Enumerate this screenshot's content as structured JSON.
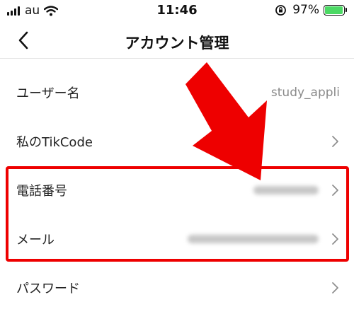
{
  "status_bar": {
    "carrier": "au",
    "time": "11:46",
    "battery_percent": "97%",
    "battery_level": 0.97,
    "battery_color": "#4cd964"
  },
  "nav": {
    "back_icon": "chevron-left-icon",
    "title": "アカウント管理"
  },
  "rows": [
    {
      "label": "ユーザー名",
      "value": "study_appli"
    },
    {
      "label": "私のTikCode"
    },
    {
      "label": "電話番号"
    },
    {
      "label": "メール"
    },
    {
      "label": "パスワード"
    }
  ],
  "annotation": {
    "highlight_color": "#ee0000",
    "arrow_color": "#ee0000"
  }
}
